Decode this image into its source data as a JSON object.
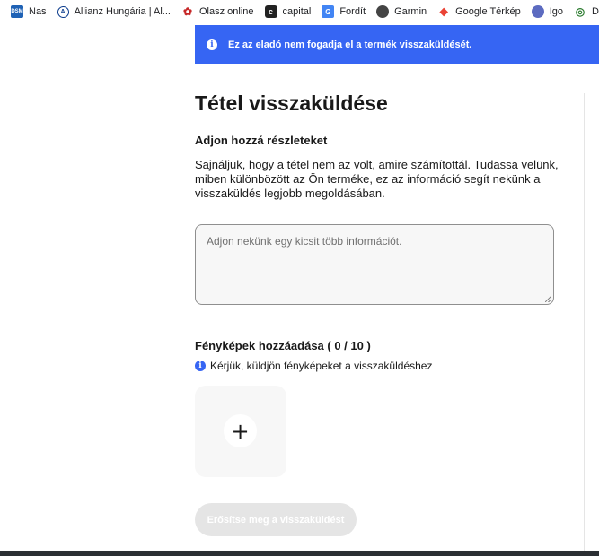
{
  "bookmarks": [
    {
      "icon": "dsm-icon",
      "icon_glyph": "DSM",
      "label": "Nas"
    },
    {
      "icon": "allianz-icon",
      "icon_glyph": "Ⓐ",
      "label": "Allianz Hungária | Al..."
    },
    {
      "icon": "olasz-icon",
      "icon_glyph": "✿",
      "label": "Olasz online"
    },
    {
      "icon": "capital-icon",
      "icon_glyph": "c",
      "label": "capital"
    },
    {
      "icon": "translate-icon",
      "icon_glyph": "G",
      "label": "Fordít"
    },
    {
      "icon": "garmin-icon",
      "icon_glyph": "◐",
      "label": "Garmin"
    },
    {
      "icon": "maps-icon",
      "icon_glyph": "⬤",
      "label": "Google Térkép"
    },
    {
      "icon": "igo-icon",
      "icon_glyph": "●",
      "label": "Igo"
    },
    {
      "icon": "dijnet-icon",
      "icon_glyph": "◎",
      "label": "Díjnet"
    }
  ],
  "banner": {
    "icon": "info-icon",
    "text": "Ez az eladó nem fogadja el a termék visszaküldését.",
    "color": "#3665f3"
  },
  "page": {
    "title": "Tétel visszaküldése",
    "section_title": "Adjon hozzá részleteket",
    "description": "Sajnáljuk, hogy a tétel nem az volt, amire számítottál. Tudassa velünk, miben különbözött az Ön terméke, ez az információ segít nekünk a visszaküldés legjobb megoldásában.",
    "details_placeholder": "Adjon nekünk egy kicsit több információt."
  },
  "photos": {
    "title": "Fényképek hozzáadása ( 0 / 10 )",
    "hint": "Kérjük, küldjön fényképeket a visszaküldéshez",
    "add_icon": "plus-icon",
    "add_glyph": "+"
  },
  "confirm_button": {
    "label": "Erősítse meg a visszaküldést",
    "state": "disabled"
  }
}
